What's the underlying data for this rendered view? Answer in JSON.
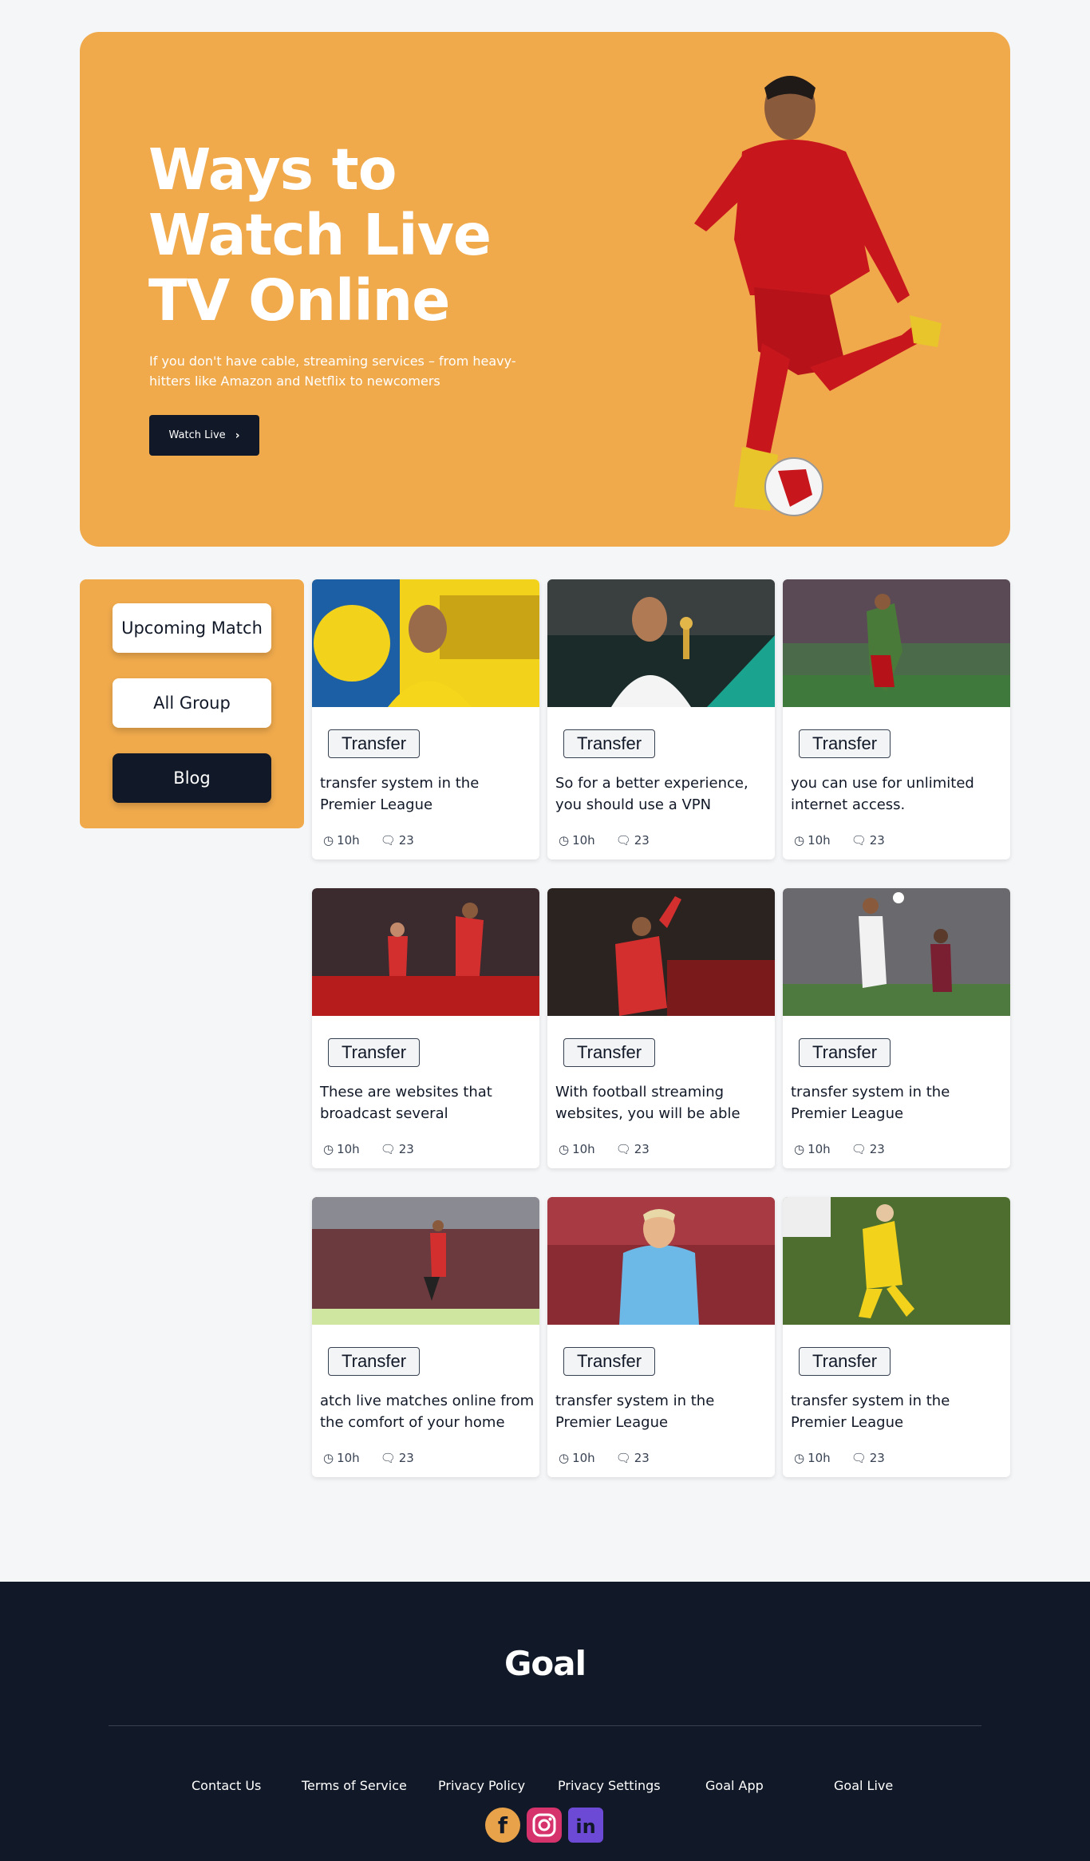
{
  "hero": {
    "title": "Ways to Watch Live TV Online",
    "subtitle": "If you don't have cable, streaming services – from heavy-hitters like Amazon and Netflix to newcomers",
    "button_label": "Watch Live",
    "bg_color": "#f0aa4c"
  },
  "sidebar": {
    "items": [
      {
        "label": "Upcoming Match"
      },
      {
        "label": "All Group"
      },
      {
        "label": "Blog"
      }
    ]
  },
  "cards": [
    {
      "tag": "Transfer",
      "title": "transfer system in the Premier League",
      "time": "10h",
      "comments": "23",
      "image": "player-photo"
    },
    {
      "tag": "Transfer",
      "title": "So for a better experience, you should use a VPN",
      "time": "10h",
      "comments": "23",
      "image": "player-photo"
    },
    {
      "tag": "Transfer",
      "title": "you can use for unlimited internet access.",
      "time": "10h",
      "comments": "23",
      "image": "player-photo"
    },
    {
      "tag": "Transfer",
      "title": "These are websites that broadcast several",
      "time": "10h",
      "comments": "23",
      "image": "player-photo"
    },
    {
      "tag": "Transfer",
      "title": "With football streaming websites, you will be able",
      "time": "10h",
      "comments": "23",
      "image": "player-photo"
    },
    {
      "tag": "Transfer",
      "title": "transfer system in the Premier League",
      "time": "10h",
      "comments": "23",
      "image": "player-photo"
    },
    {
      "tag": "Transfer",
      "title": "atch live matches online from the comfort of your home",
      "time": "10h",
      "comments": "23",
      "image": "player-photo"
    },
    {
      "tag": "Transfer",
      "title": "transfer system in the Premier League",
      "time": "10h",
      "comments": "23",
      "image": "player-photo"
    },
    {
      "tag": "Transfer",
      "title": "transfer system in the Premier League",
      "time": "10h",
      "comments": "23",
      "image": "player-photo"
    }
  ],
  "footer": {
    "logo": "Goal",
    "links": [
      "Contact Us",
      "Terms of Service",
      "Privacy Policy",
      "Privacy Settings",
      "Goal App",
      "Goal Live"
    ],
    "social": [
      "facebook-icon",
      "instagram-icon",
      "linkedin-icon"
    ],
    "bg_color": "#111827"
  }
}
